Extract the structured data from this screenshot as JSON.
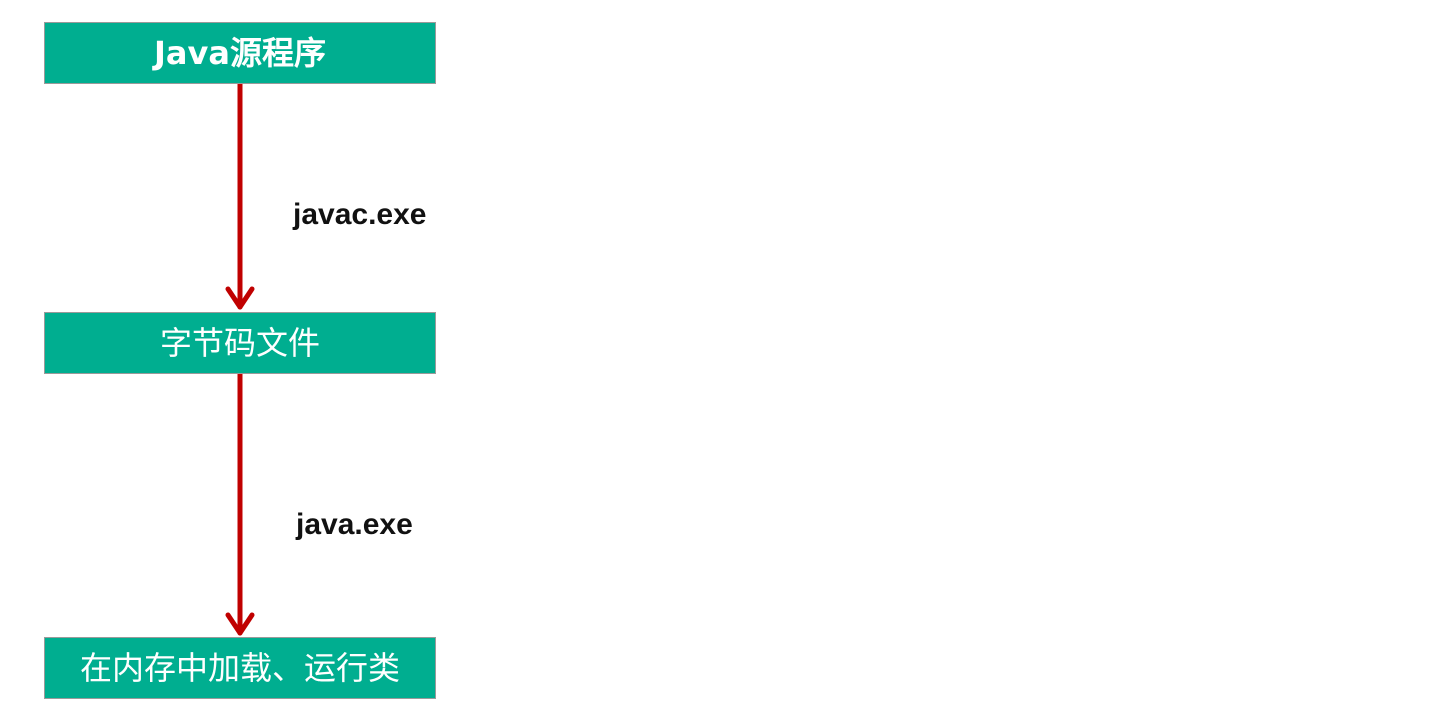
{
  "nodes": {
    "source": "Java源程序",
    "bytecode": "字节码文件",
    "runtime": "在内存中加载、运行类"
  },
  "edges": {
    "compile": "javac.exe",
    "run": "java.exe"
  },
  "colors": {
    "node_fill": "#00ae90",
    "node_border": "#9a9a9a",
    "arrow": "#c00000",
    "text": "#111111"
  }
}
